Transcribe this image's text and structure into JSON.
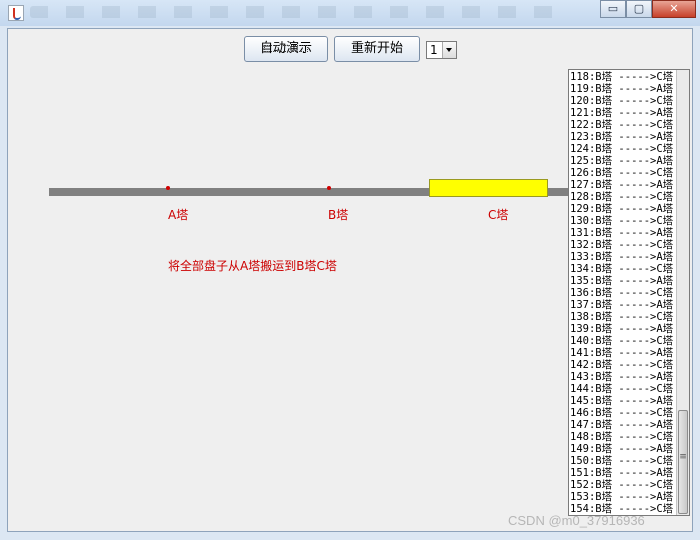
{
  "window": {
    "min_glyph": "▭",
    "max_glyph": "▢",
    "close_glyph": "✕"
  },
  "toolbar": {
    "auto_demo_label": "自动演示",
    "restart_label": "重新开始",
    "disk_count_value": "1"
  },
  "towers": {
    "a_label": "A塔",
    "b_label": "B塔",
    "c_label": "C塔"
  },
  "instruction": "将全部盘子从A塔搬运到B塔C塔",
  "log": {
    "lines": [
      "118:B塔 ----->C塔",
      "119:B塔 ----->A塔",
      "120:B塔 ----->C塔",
      "121:B塔 ----->A塔",
      "122:B塔 ----->C塔",
      "123:B塔 ----->A塔",
      "124:B塔 ----->C塔",
      "125:B塔 ----->A塔",
      "126:B塔 ----->C塔",
      "127:B塔 ----->A塔",
      "128:B塔 ----->C塔",
      "129:B塔 ----->A塔",
      "130:B塔 ----->C塔",
      "131:B塔 ----->A塔",
      "132:B塔 ----->C塔",
      "133:B塔 ----->A塔",
      "134:B塔 ----->C塔",
      "135:B塔 ----->A塔",
      "136:B塔 ----->C塔",
      "137:B塔 ----->A塔",
      "138:B塔 ----->C塔",
      "139:B塔 ----->A塔",
      "140:B塔 ----->C塔",
      "141:B塔 ----->A塔",
      "142:B塔 ----->C塔",
      "143:B塔 ----->A塔",
      "144:B塔 ----->C塔",
      "145:B塔 ----->A塔",
      "146:B塔 ----->C塔",
      "147:B塔 ----->A塔",
      "148:B塔 ----->C塔",
      "149:B塔 ----->A塔",
      "150:B塔 ----->C塔",
      "151:B塔 ----->A塔",
      "152:B塔 ----->C塔",
      "153:B塔 ----->A塔",
      "154:B塔 ----->C塔"
    ],
    "scroll_position": 0.95
  },
  "watermark": "CSDN @m0_37916936",
  "colors": {
    "label_red": "#cc0000",
    "disk_yellow": "#ffff00",
    "rail_gray": "#808080"
  }
}
